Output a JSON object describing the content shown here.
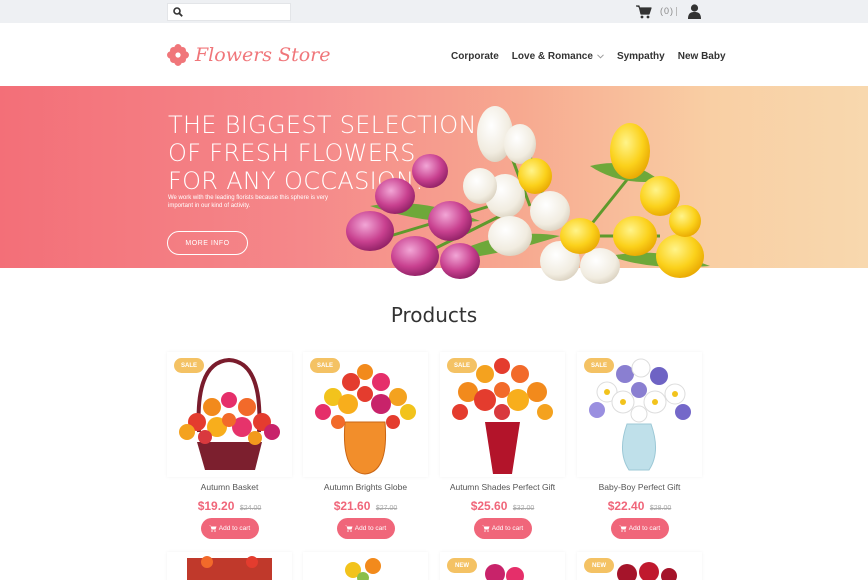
{
  "topbar": {
    "search_placeholder": "",
    "cart_count": "(0)",
    "icons": {
      "search": "search-icon",
      "cart": "cart-icon",
      "user": "user-icon"
    }
  },
  "header": {
    "logo_text": "Flowers Store",
    "nav": [
      {
        "label": "Corporate",
        "has_dropdown": false
      },
      {
        "label": "Love & Romance",
        "has_dropdown": true
      },
      {
        "label": "Sympathy",
        "has_dropdown": false
      },
      {
        "label": "New Baby",
        "has_dropdown": false
      }
    ]
  },
  "hero": {
    "title_lines": [
      "THE BIGGEST SELECTION",
      "OF FRESH FLOWERS",
      "FOR ANY OCCASION!"
    ],
    "subtitle": "We work with the leading florists because this sphere is very important in our kind of activity.",
    "button_label": "MORE INFO"
  },
  "products": {
    "title": "Products",
    "items": [
      {
        "badge": "SALE",
        "name": "Autumn Basket",
        "price": "$19.20",
        "old_price": "$24.00",
        "button": "Add to cart"
      },
      {
        "badge": "SALE",
        "name": "Autumn Brights Globe",
        "price": "$21.60",
        "old_price": "$27.00",
        "button": "Add to cart"
      },
      {
        "badge": "SALE",
        "name": "Autumn Shades Perfect Gift",
        "price": "$25.60",
        "old_price": "$32.00",
        "button": "Add to cart"
      },
      {
        "badge": "SALE",
        "name": "Baby-Boy Perfect Gift",
        "price": "$22.40",
        "old_price": "$28.00",
        "button": "Add to cart"
      }
    ],
    "row2_badges": [
      "",
      "",
      "NEW",
      "NEW"
    ]
  },
  "colors": {
    "accent": "#f0667a",
    "logo": "#f0767a",
    "badge": "#f4c264",
    "topbar": "#eef0f3"
  }
}
